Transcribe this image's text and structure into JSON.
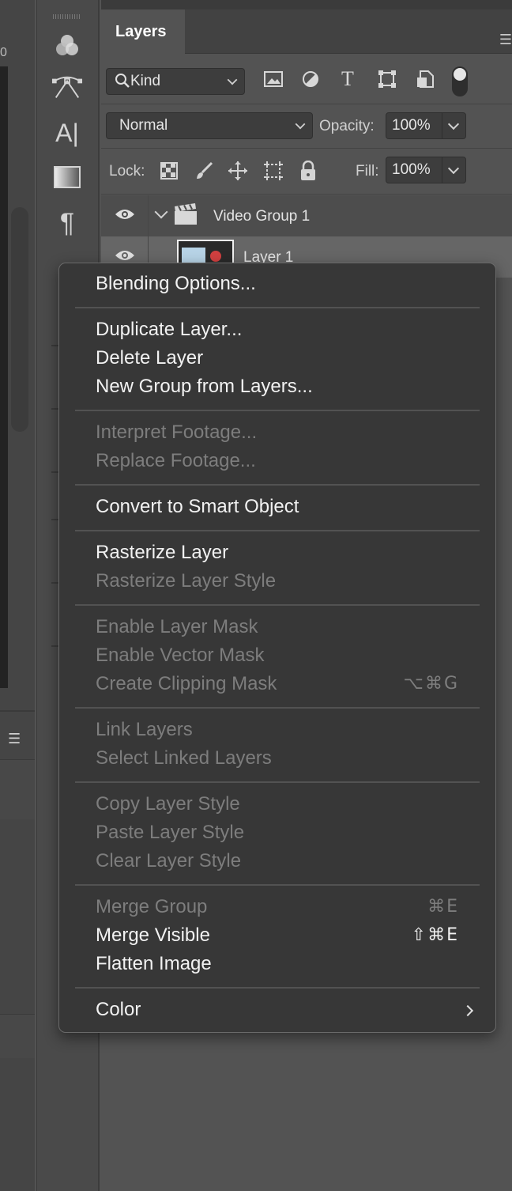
{
  "left_strip": {
    "ruler_number": "0"
  },
  "panel": {
    "tab_label": "Layers",
    "filter": {
      "kind_label": "Kind",
      "icons": [
        "image-filter-icon",
        "adjustment-filter-icon",
        "type-filter-icon",
        "shape-filter-icon",
        "smart-object-filter-icon",
        "filter-toggle-icon"
      ]
    },
    "blend": {
      "mode": "Normal",
      "opacity_label": "Opacity:",
      "opacity_value": "100%"
    },
    "lock": {
      "label": "Lock:",
      "icons": [
        "lock-transparent-icon",
        "lock-image-icon",
        "lock-position-icon",
        "lock-artboard-icon",
        "lock-all-icon"
      ],
      "fill_label": "Fill:",
      "fill_value": "100%"
    },
    "layers": [
      {
        "name": "Video Group 1",
        "type": "video-group",
        "visible": true,
        "expanded": true
      },
      {
        "name": "Layer 1",
        "type": "layer",
        "visible": true,
        "selected": true
      }
    ]
  },
  "tools": [
    "channels-icon",
    "pen-path-icon",
    "character-icon",
    "gradient-icon",
    "paragraph-icon"
  ],
  "context_menu": {
    "items": [
      {
        "label": "Blending Options...",
        "enabled": true
      },
      {
        "label": "Duplicate Layer...",
        "enabled": true
      },
      {
        "label": "Delete Layer",
        "enabled": true
      },
      {
        "label": "New Group from Layers...",
        "enabled": true
      },
      {
        "label": "Interpret Footage...",
        "enabled": false
      },
      {
        "label": "Replace Footage...",
        "enabled": false
      },
      {
        "label": "Convert to Smart Object",
        "enabled": true
      },
      {
        "label": "Rasterize Layer",
        "enabled": true
      },
      {
        "label": "Rasterize Layer Style",
        "enabled": false
      },
      {
        "label": "Enable Layer Mask",
        "enabled": false
      },
      {
        "label": "Enable Vector Mask",
        "enabled": false
      },
      {
        "label": "Create Clipping Mask",
        "enabled": false,
        "shortcut": "⌥⌘G"
      },
      {
        "label": "Link Layers",
        "enabled": false
      },
      {
        "label": "Select Linked Layers",
        "enabled": false
      },
      {
        "label": "Copy Layer Style",
        "enabled": false
      },
      {
        "label": "Paste Layer Style",
        "enabled": false
      },
      {
        "label": "Clear Layer Style",
        "enabled": false
      },
      {
        "label": "Merge Group",
        "enabled": false,
        "shortcut": "⌘E"
      },
      {
        "label": "Merge Visible",
        "enabled": true,
        "shortcut": "⇧⌘E"
      },
      {
        "label": "Flatten Image",
        "enabled": true
      },
      {
        "label": "Color",
        "enabled": true,
        "submenu": true
      }
    ]
  },
  "colors": {
    "menu_bg": "#373737",
    "enabled_text": "#f2f2f2",
    "disabled_text": "#7d7d7d",
    "panel_bg": "#535353",
    "selected_layer_bg": "#666666"
  }
}
